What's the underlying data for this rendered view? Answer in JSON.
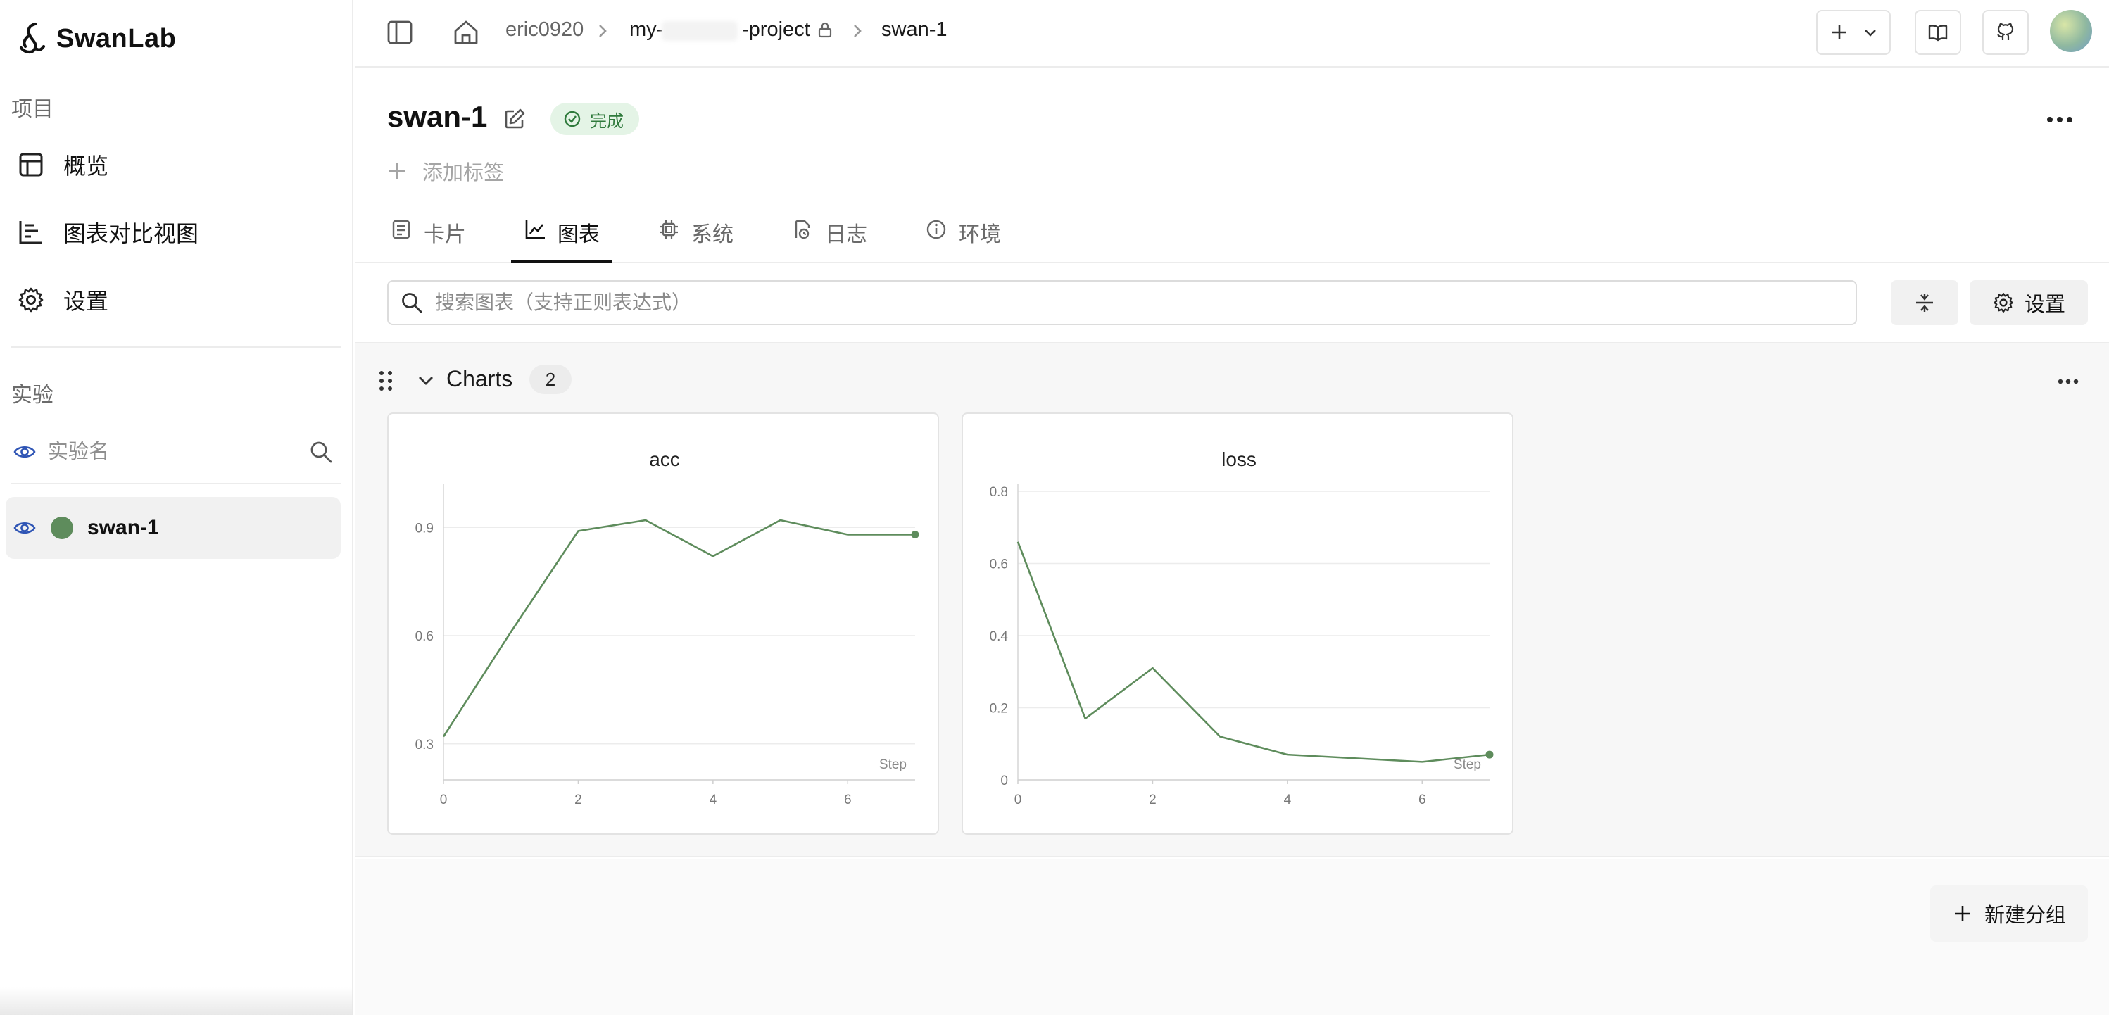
{
  "brand": {
    "name": "SwanLab"
  },
  "sidebar": {
    "project_section": "项目",
    "items": [
      {
        "label": "概览",
        "icon": "table-icon"
      },
      {
        "label": "图表对比视图",
        "icon": "bar-chart-icon"
      },
      {
        "label": "设置",
        "icon": "gear-icon"
      }
    ],
    "experiment_section": "实验",
    "search_placeholder": "实验名",
    "experiments": [
      {
        "name": "swan-1",
        "color": "#5e8c5c",
        "visible": true
      }
    ]
  },
  "topbar": {
    "breadcrumb": {
      "user": "eric0920",
      "project_prefix": "my-",
      "project_suffix": "-project",
      "run": "swan-1"
    }
  },
  "run": {
    "title": "swan-1",
    "status": "完成",
    "status_color": "#2f7a3c",
    "add_tag": "添加标签"
  },
  "tabs": [
    {
      "label": "卡片",
      "icon": "card-icon",
      "active": false
    },
    {
      "label": "图表",
      "icon": "line-chart-icon",
      "active": true
    },
    {
      "label": "系统",
      "icon": "cpu-icon",
      "active": false
    },
    {
      "label": "日志",
      "icon": "log-icon",
      "active": false
    },
    {
      "label": "环境",
      "icon": "info-icon",
      "active": false
    }
  ],
  "chart_search": {
    "placeholder": "搜索图表（支持正则表达式）"
  },
  "toolbar": {
    "settings_label": "设置"
  },
  "group": {
    "title": "Charts",
    "count": "2"
  },
  "new_group_label": "新建分组",
  "chart_data": [
    {
      "type": "line",
      "title": "acc",
      "xlabel": "Step",
      "x": [
        0,
        1,
        2,
        3,
        4,
        5,
        6,
        7
      ],
      "series": [
        {
          "values": [
            0.32,
            0.61,
            0.89,
            0.92,
            0.82,
            0.92,
            0.88,
            0.88
          ],
          "color": "#5e8c5c"
        }
      ],
      "xlim": [
        0,
        7
      ],
      "ylim": [
        0.2,
        1.0
      ],
      "xticks": [
        0,
        2,
        4,
        6
      ],
      "yticks": [
        0.3,
        0.6,
        0.9
      ],
      "grid": true
    },
    {
      "type": "line",
      "title": "loss",
      "xlabel": "Step",
      "x": [
        0,
        1,
        2,
        3,
        4,
        5,
        6,
        7
      ],
      "series": [
        {
          "values": [
            0.66,
            0.17,
            0.31,
            0.12,
            0.07,
            0.06,
            0.05,
            0.07
          ],
          "color": "#5e8c5c"
        }
      ],
      "xlim": [
        0,
        7
      ],
      "ylim": [
        0,
        0.8
      ],
      "xticks": [
        0,
        2,
        4,
        6
      ],
      "yticks": [
        0,
        0.2,
        0.4,
        0.6,
        0.8
      ],
      "grid": true
    }
  ]
}
